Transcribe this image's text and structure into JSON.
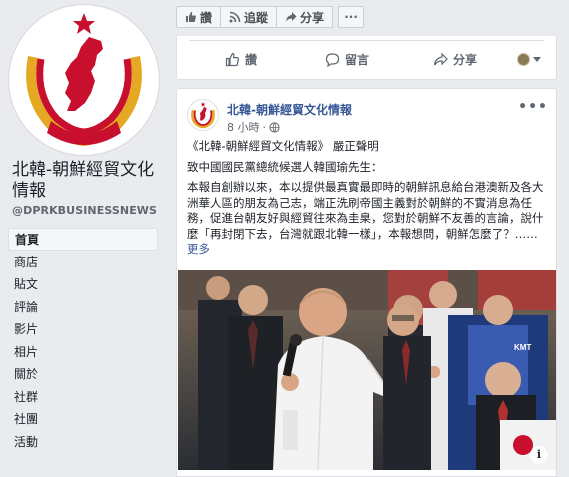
{
  "page": {
    "name": "北韓-朝鮮經貿文化情報",
    "handle": "@DPRKBUSINESSNEWS"
  },
  "nav": [
    {
      "label": "首頁",
      "active": true
    },
    {
      "label": "商店"
    },
    {
      "label": "貼文"
    },
    {
      "label": "評論"
    },
    {
      "label": "影片"
    },
    {
      "label": "相片"
    },
    {
      "label": "關於"
    },
    {
      "label": "社群"
    },
    {
      "label": "社團"
    },
    {
      "label": "活動"
    }
  ],
  "toolbar": {
    "like": "讚",
    "follow": "追蹤",
    "share": "分享",
    "more": "···"
  },
  "prev_actions": {
    "like": "讚",
    "comment": "留言",
    "share": "分享"
  },
  "post": {
    "author": "北韓-朝鮮經貿文化情報",
    "time": "8 小時",
    "line1": "《北韓-朝鮮經貿文化情報》 嚴正聲明",
    "line2": "致中國國民黨總統候選人韓國瑜先生：",
    "body": "本報自創辦以來，本以提供最真實最即時的朝鮮訊息給台港澳新及各大洲華人區的朋友為己志，端正洗刷帝國主義對於朝鮮的不實消息為任務，促進台朝友好與經貿往來為圭臬，您對於朝鮮不友善的言論，說什麼「再封閉下去，台灣就跟北韓一樣」，本報想問，朝鮮怎麼了？……",
    "see_more": "更多",
    "info": "i"
  },
  "colors": {
    "bg": "#e9ebee",
    "link": "#385898",
    "flag_red": "#c8102e",
    "wreath_gold": "#e5a822"
  }
}
